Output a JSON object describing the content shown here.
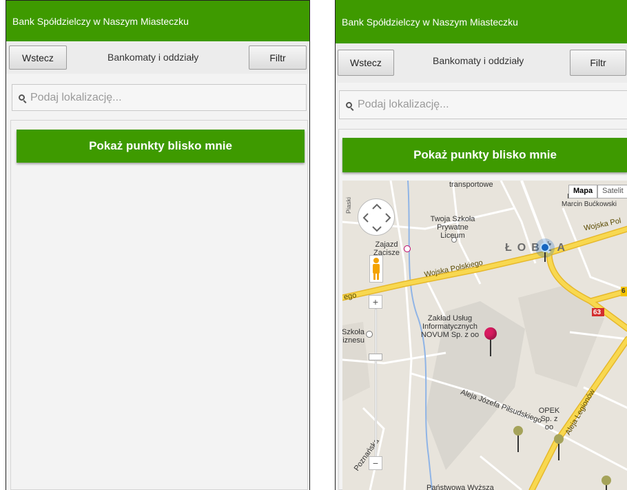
{
  "app": {
    "title": "Bank Spółdzielczy w Naszym Miasteczku"
  },
  "toolbar": {
    "back_label": "Wstecz",
    "title": "Bankomaty i oddziały",
    "filter_label": "Filtr"
  },
  "search": {
    "placeholder": "Podaj lokalizację..."
  },
  "nearby_button": {
    "label": "Pokaż punkty blisko mnie"
  },
  "map": {
    "map_type": {
      "map_label": "Mapa",
      "satellite_label": "Satelit"
    },
    "zoom_in_label": "+",
    "zoom_out_label": "−",
    "labels": {
      "transport": "transportowe",
      "area": "ŁOBŻA",
      "road_wp_left": "Wojska Polskiego",
      "road_wp_right": "Wojska Pol",
      "road_ego": "ego",
      "school": "Twoja Szkoła Prywatne Liceum",
      "inn": "Zajazd Zacisze",
      "company": "Zakład Usług Informatycznych NOVUM Sp. z oo",
      "business_school": "Szkoła Biznesu",
      "road_pilsudski": "Aleja Józefa Piłsudskiego",
      "opek": "OPEK Sp. z oo",
      "road_legionow": "Aleja Legionów",
      "road_poznanska": "Poznańska",
      "university": "Państwowa Wyższa",
      "person": "Marcin Bućkowski",
      "person_prefix": "In",
      "road_no_63": "63",
      "road_no_6": "6",
      "piaski": "Piaski"
    },
    "colors": {
      "main_road": "#f5d34b",
      "minor_road": "#ffffff",
      "water": "#8fb4e6",
      "building": "#d6d3cc",
      "marker_pink": "#d81b60",
      "marker_blue": "#1565c0",
      "marker_olive": "#a5a35a"
    }
  },
  "colors": {
    "accent_green": "#3e9a00"
  }
}
